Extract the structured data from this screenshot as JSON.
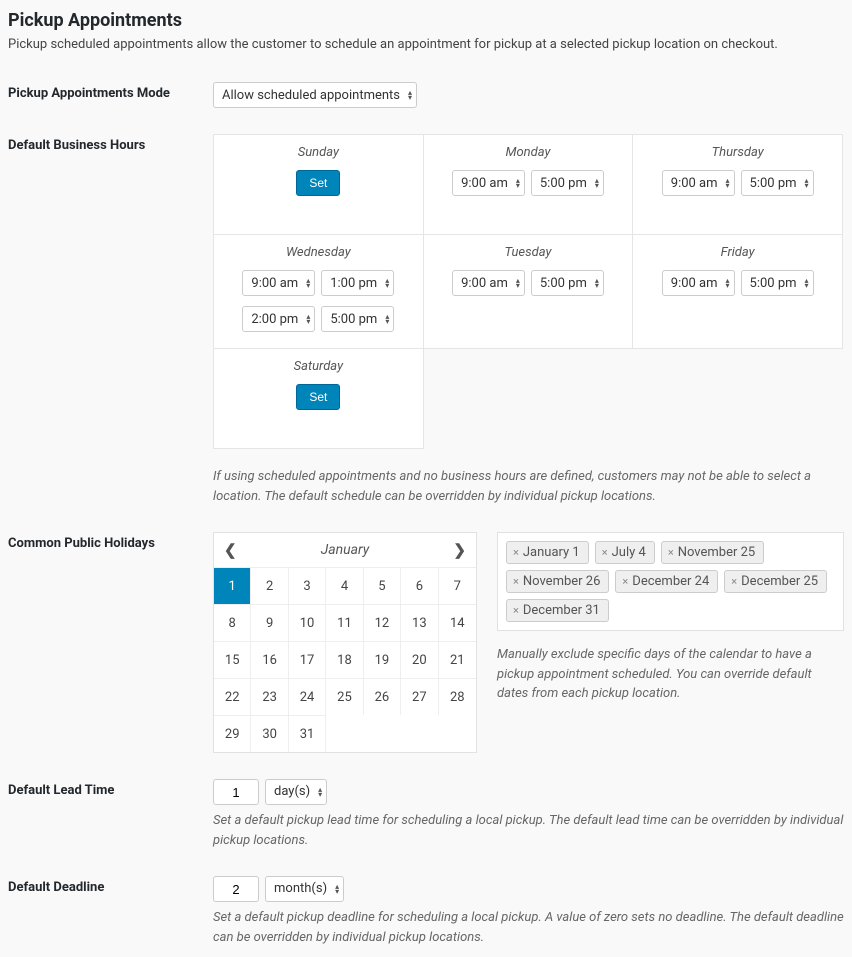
{
  "title": "Pickup Appointments",
  "description": "Pickup scheduled appointments allow the customer to schedule an appointment for pickup at a selected pickup location on checkout.",
  "mode": {
    "label": "Pickup Appointments Mode",
    "value": "Allow scheduled appointments"
  },
  "hours": {
    "label": "Default Business Hours",
    "set_label": "Set",
    "hint": "If using scheduled appointments and no business hours are defined, customers may not be able to select a location. The default schedule can be overridden by individual pickup locations.",
    "days": [
      {
        "name": "Sunday",
        "ranges": []
      },
      {
        "name": "Monday",
        "ranges": [
          [
            "9:00 am",
            "5:00 pm"
          ]
        ]
      },
      {
        "name": "Thursday",
        "ranges": [
          [
            "9:00 am",
            "5:00 pm"
          ]
        ]
      },
      {
        "name": "Wednesday",
        "ranges": [
          [
            "9:00 am",
            "1:00 pm"
          ],
          [
            "2:00 pm",
            "5:00 pm"
          ]
        ]
      },
      {
        "name": "Tuesday",
        "ranges": [
          [
            "9:00 am",
            "5:00 pm"
          ]
        ]
      },
      {
        "name": "Friday",
        "ranges": [
          [
            "9:00 am",
            "5:00 pm"
          ]
        ]
      },
      {
        "name": "Saturday",
        "ranges": []
      }
    ]
  },
  "holidays": {
    "label": "Common Public Holidays",
    "month": "January",
    "selected_day": 1,
    "days_in_month": 31,
    "tags": [
      "January 1",
      "July 4",
      "November 25",
      "November 26",
      "December 24",
      "December 25",
      "December 31"
    ],
    "hint": "Manually exclude specific days of the calendar to have a pickup appointment scheduled. You can override default dates from each pickup location."
  },
  "lead": {
    "label": "Default Lead Time",
    "value": "1",
    "unit": "day(s)",
    "hint": "Set a default pickup lead time for scheduling a local pickup. The default lead time can be overridden by individual pickup locations."
  },
  "deadline": {
    "label": "Default Deadline",
    "value": "2",
    "unit": "month(s)",
    "hint": "Set a default pickup deadline for scheduling a local pickup. A value of zero sets no deadline. The default deadline can be overridden by individual pickup locations."
  }
}
